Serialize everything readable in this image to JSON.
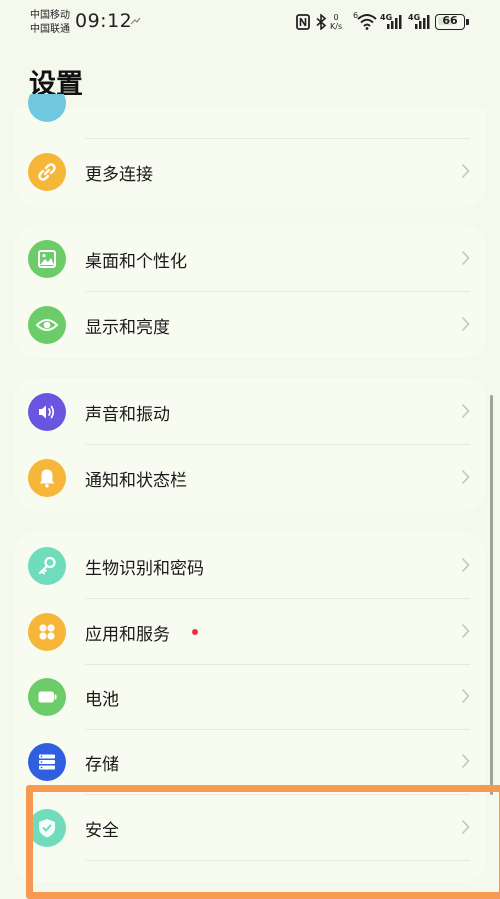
{
  "status_bar": {
    "carrier_1": "中国移动",
    "carrier_2": "中国联通",
    "time": "09:12",
    "speed_value": "0",
    "speed_unit": "K/s",
    "sim1_network": "4G",
    "sim2_network": "4G",
    "wifi_badge": "6",
    "battery": "66",
    "battery_level": 0.66
  },
  "page_title": "设置",
  "menu": {
    "more_connections": "更多连接",
    "desktop_personalization": "桌面和个性化",
    "display_brightness": "显示和亮度",
    "sound_vibration": "声音和振动",
    "notification_statusbar": "通知和状态栏",
    "biometrics_password": "生物识别和密码",
    "apps_services": "应用和服务",
    "battery": "电池",
    "storage": "存储",
    "security": "安全"
  },
  "colors": {
    "background": "#f5f8ec",
    "card": "#f8fbf0",
    "highlight": "#f59a4e",
    "badge": "#e5343a",
    "icon_more_connections": "#f5b63a",
    "icon_desktop": "#6ccc6a",
    "icon_display": "#6ccc6a",
    "icon_sound": "#6a55e0",
    "icon_notification": "#f5b63a",
    "icon_biometrics": "#6fdcbc",
    "icon_apps": "#f5b63a",
    "icon_battery": "#6ccc6a",
    "icon_storage": "#2f5fe0",
    "icon_security": "#6fdcbc"
  },
  "icons": [
    "nfc-icon",
    "bluetooth-icon",
    "wifi-icon",
    "signal-icon",
    "link-icon",
    "image-icon",
    "eye-icon",
    "speaker-icon",
    "bell-icon",
    "key-icon",
    "apps-grid-icon",
    "battery-icon",
    "storage-icon",
    "shield-icon",
    "chevron-right-icon"
  ]
}
